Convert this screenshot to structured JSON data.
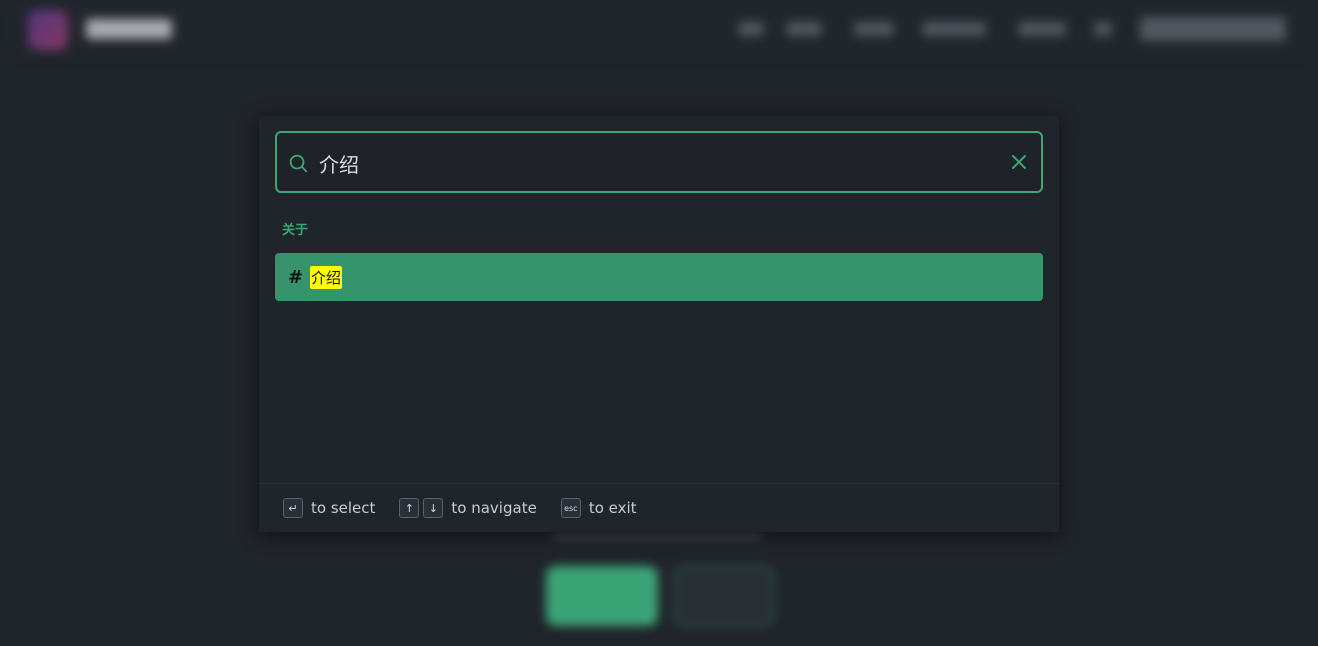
{
  "search": {
    "value": "介绍",
    "icon": "search-icon",
    "clear_icon": "close-icon"
  },
  "results": {
    "section_label": "关于",
    "items": [
      {
        "prefix": "#",
        "title": "介绍"
      }
    ]
  },
  "footer": {
    "select": {
      "key": "↵",
      "label": "to select"
    },
    "navigate": {
      "key_up": "↑",
      "key_down": "↓",
      "label": "to navigate"
    },
    "exit": {
      "key": "esc",
      "label": "to exit"
    }
  },
  "colors": {
    "accent": "#3aa775",
    "selected_bg": "#35946b",
    "highlight": "#ffff00",
    "background": "#20242b"
  }
}
